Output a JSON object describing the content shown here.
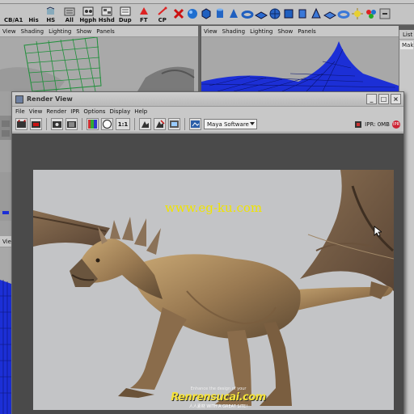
{
  "shelf": {
    "buttons": [
      "CB/A1",
      "His",
      "HS",
      "All",
      "Hgph",
      "Hshd",
      "Dup",
      "FT",
      "CP"
    ]
  },
  "panels": {
    "left_top_menu": [
      "View",
      "Shading",
      "Lighting",
      "Show",
      "Panels"
    ],
    "right_top_menu": [
      "View",
      "Shading",
      "Lighting",
      "Show",
      "Panels"
    ],
    "left_bottom_menu": [
      "View"
    ]
  },
  "side_panel": {
    "tab": "List",
    "row": "Make"
  },
  "render_view": {
    "title": "Render View",
    "menu": [
      "File",
      "View",
      "Render",
      "IPR",
      "Options",
      "Display",
      "Help"
    ],
    "zoom_label": "1:1",
    "renderer": "Maya Software",
    "ipr_status": "IPR: 0MB",
    "ipr_badge": "IPR"
  },
  "render_image": {
    "watermark": "www.eg-ku.com"
  },
  "logo": {
    "tagline": "Enhance the design of your",
    "brand": "Renrensucai.com",
    "sub": "人人素材 WITH A GREAT SITE!"
  },
  "colors": {
    "window_chrome": "#c8c8c8",
    "render_background": "#c3c4c6",
    "watermark": "#f0e400",
    "wireframe_green": "#1f8f3a",
    "wireframe_blue": "#1c2fd6"
  }
}
